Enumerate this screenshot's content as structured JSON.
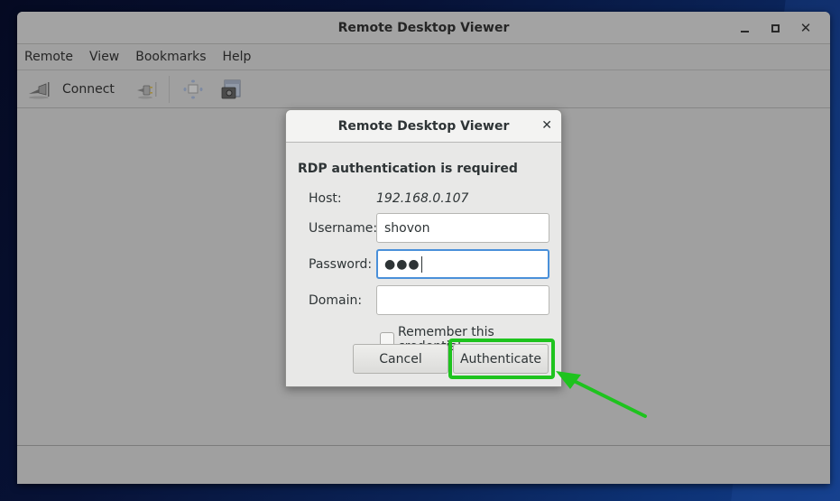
{
  "window": {
    "title": "Remote Desktop Viewer",
    "controls": {
      "minimize": "minimize-icon",
      "maximize": "maximize-icon",
      "close": "close-icon"
    }
  },
  "menubar": {
    "items": [
      {
        "label": "Remote"
      },
      {
        "label": "View"
      },
      {
        "label": "Bookmarks"
      },
      {
        "label": "Help"
      }
    ]
  },
  "toolbar": {
    "connect_label": "Connect",
    "icons": [
      "connect-plug-icon",
      "disconnect-plug-icon",
      "fullscreen-icon",
      "screenshot-icon"
    ]
  },
  "dialog": {
    "title": "Remote Desktop Viewer",
    "heading": "RDP authentication is required",
    "host_label": "Host:",
    "host_value": "192.168.0.107",
    "username_label": "Username:",
    "username_value": "shovon",
    "password_label": "Password:",
    "password_masked": "●●●",
    "domain_label": "Domain:",
    "domain_value": "",
    "remember_label": "Remember this credential",
    "remember_checked": false,
    "cancel_label": "Cancel",
    "authenticate_label": "Authenticate"
  },
  "annotation": {
    "color": "#1ec31e",
    "target": "authenticate-button"
  }
}
